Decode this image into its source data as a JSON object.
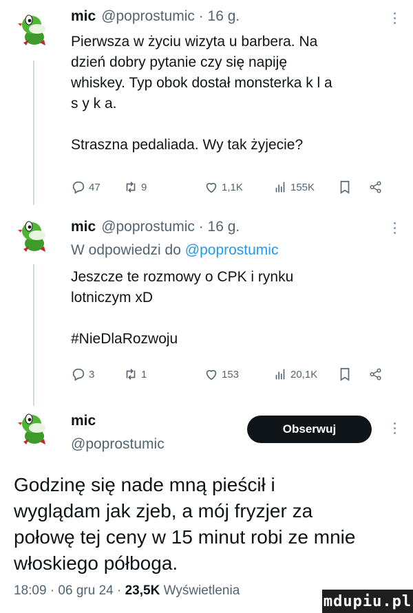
{
  "colors": {
    "link": "#1d9bf0",
    "secondary": "#536471",
    "text": "#0f1419",
    "button": "#0f1419"
  },
  "tweets": [
    {
      "name": "mic",
      "meta": "@poprostumic · 16 g.",
      "text": "Pierwsza w życiu wizyta u barbera. Na\ndzień dobry pytanie czy się napiję\nwhiskey. Typ obok dostał monsterka k l a\ns y k a.\n\nStraszna pedaliada. Wy tak żyjecie?",
      "stats": {
        "replies": "47",
        "retweets": "9",
        "likes": "1,1K",
        "views": "155K"
      }
    },
    {
      "name": "mic",
      "meta": "@poprostumic · 16 g.",
      "reply_prefix": "W odpowiedzi do ",
      "reply_handle": "@poprostumic",
      "text": "Jeszcze te rozmowy o CPK i rynku\nlotniczym xD\n\n#NieDlaRozwoju",
      "stats": {
        "replies": "3",
        "retweets": "1",
        "likes": "153",
        "views": "20,1K"
      }
    }
  ],
  "main_tweet": {
    "name": "mic",
    "handle": "@poprostumic",
    "follow_label": "Obserwuj",
    "text": "Godzinę się nade mną pieścił i\nwyglądam jak zjeb, a mój fryzjer za\npołowę tej ceny w 15 minut robi ze mnie\nwłoskiego półboga.",
    "time": "18:09 · 06 gru 24 · ",
    "views": "23,5K",
    "views_label": " Wyświetlenia"
  },
  "watermark": "mdupiu.pl"
}
